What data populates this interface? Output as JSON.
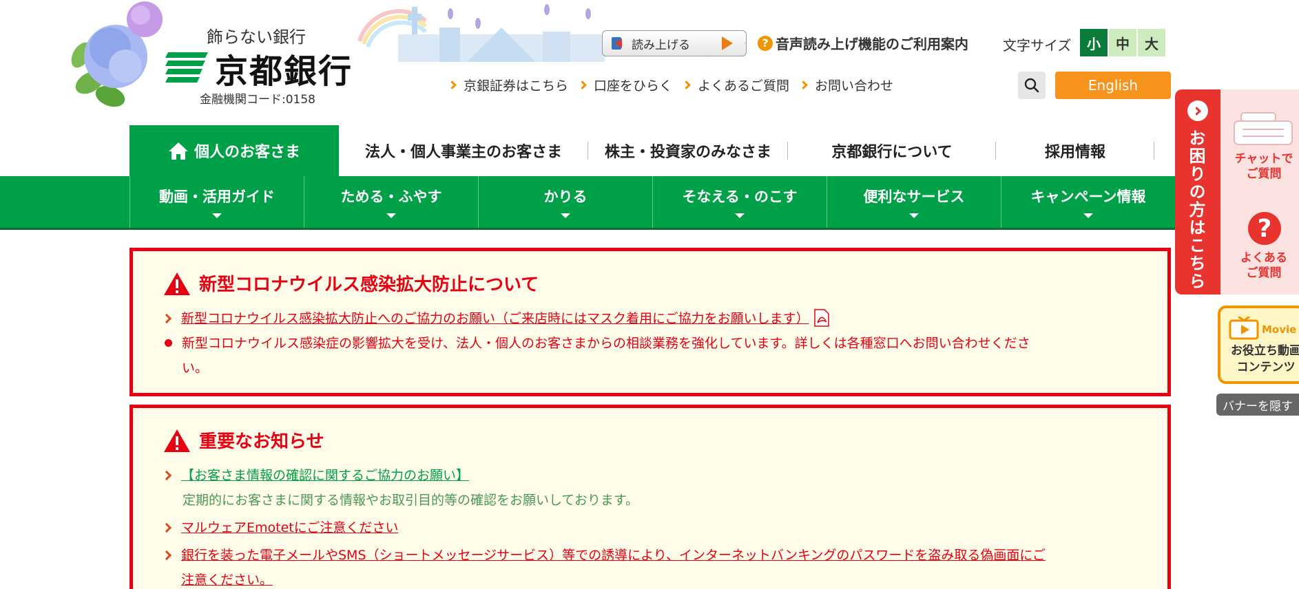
{
  "header": {
    "tagline": "飾らない銀行",
    "bank_name": "京都銀行",
    "bank_code": "金融機関コード:0158",
    "read_aloud_label": "読み上げる",
    "voice_guide_label": "音声読み上げ機能のご利用案内",
    "font_size_label": "文字サイズ",
    "font_sizes": [
      "小",
      "中",
      "大"
    ],
    "sublinks": [
      "京銀証券はこちら",
      "口座をひらく",
      "よくあるご質問",
      "お問い合わせ"
    ],
    "english_label": "English"
  },
  "primary_nav": [
    "個人のお客さま",
    "法人・個人事業主のお客さま",
    "株主・投資家のみなさま",
    "京都銀行について",
    "採用情報"
  ],
  "secondary_nav": [
    "動画・活用ガイド",
    "ためる・ふやす",
    "かりる",
    "そなえる・のこす",
    "便利なサービス",
    "キャンペーン情報"
  ],
  "notice_covid": {
    "title": "新型コロナウイルス感染拡大防止について",
    "link": "新型コロナウイルス感染拡大防止へのご協力のお願い（ご来店時にはマスク着用にご協力をお願いします）",
    "bullet_line1": "新型コロナウイルス感染症の影響拡大を受け、法人・個人のお客さまからの相談業務を強化しています。詳しくは各種窓口へお問い合わせくださ",
    "bullet_line2": "い。"
  },
  "notice_important": {
    "title": "重要なお知らせ",
    "link1": "【お客さま情報の確認に関するご協力のお願い】",
    "link1_desc": "定期的にお客さまに関する情報やお取引目的等の確認をお願いしております。",
    "link2": "マルウェアEmotetにご注意ください",
    "link3_line1": "銀行を装った電子メールやSMS（ショートメッセージサービス）等での誘導により、インターネットバンキングのパスワードを盗み取る偽画面にご",
    "link3_line2": "注意ください。"
  },
  "side": {
    "help_tab": "お困りの方はこちら",
    "chat_line1": "チャットで",
    "chat_line2": "ご質問",
    "faq_line1": "よくある",
    "faq_line2": "ご質問",
    "movie_tag": "Movie",
    "movie_line1": "お役立ち動画",
    "movie_line2": "コンテンツ",
    "hide_banner": "バナーを隠す"
  },
  "colors": {
    "brand_green": "#00a048",
    "alert_red": "#e60012",
    "accent_orange": "#f7941d"
  }
}
